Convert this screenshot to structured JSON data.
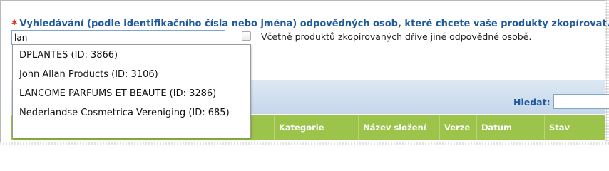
{
  "form": {
    "required_marker": "*",
    "prompt": "Vyhledávání (podle identifikačního čísla nebo jména) odpovědných osob, které chcete vaše produkty zkopírovat.",
    "search_value": "lan",
    "include_previous_label": "Včetně produktů zkopírovaných dříve jiné odpovědné osobě."
  },
  "autocomplete": {
    "options": [
      "DPLANTES (ID: 3866)",
      "John Allan Products (ID: 3106)",
      "LANCOME PARFUMS ET BEAUTE (ID: 3286)",
      "Nederlandse Cosmetrica Vereniging (ID: 685)"
    ]
  },
  "grid": {
    "search_label": "Hledat:",
    "columns": [
      "Kategorie",
      "Název složení",
      "Verze",
      "Datum",
      "Stav"
    ]
  },
  "colors": {
    "accent_blue": "#1f5a9c",
    "required_red": "#d62828",
    "header_green": "#9cc34a"
  }
}
